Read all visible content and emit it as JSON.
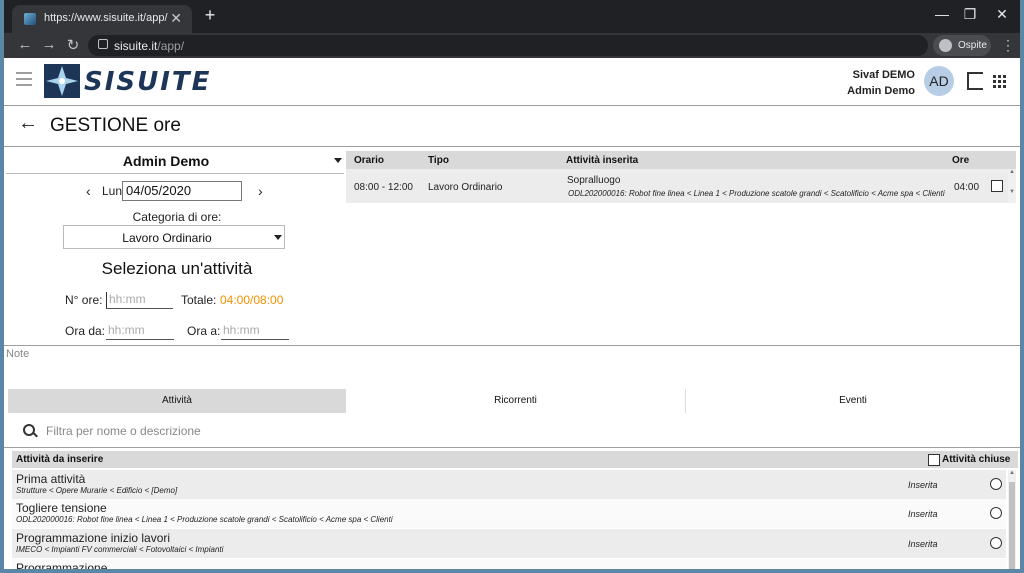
{
  "browser": {
    "tab_title": "https://www.sisuite.it/app/",
    "tab_close": "✕",
    "new_tab": "+",
    "url_host": "sisuite.it",
    "url_path": "/app/",
    "profile": "Ospite",
    "minimize": "—",
    "restore": "❐",
    "close": "✕",
    "back": "←",
    "forward": "→",
    "reload": "↻",
    "menu": "⋮"
  },
  "app": {
    "brand": "SISUITE",
    "user_line1": "Sivaf DEMO",
    "user_line2": "Admin Demo",
    "avatar": "AD"
  },
  "page": {
    "back_arrow": "←",
    "title": "GESTIONE ore"
  },
  "form": {
    "user": "Admin Demo",
    "day_prev": "‹",
    "day_label": "Lun",
    "date": "04/05/2020",
    "day_next": "›",
    "category_label": "Categoria di ore:",
    "category": "Lavoro Ordinario",
    "select_title": "Seleziona un'attività",
    "hours_label": "N° ore:",
    "hours_placeholder": "hh:mm",
    "total_label": "Totale:",
    "total_value": "04:00/08:00",
    "from_label": "Ora da:",
    "from_placeholder": "hh:mm",
    "to_label": "Ora a:",
    "to_placeholder": "hh:mm"
  },
  "entries": {
    "columns": [
      "Orario",
      "Tipo",
      "Attività inserita",
      "Ore"
    ],
    "rows": [
      {
        "orario": "08:00 - 12:00",
        "tipo": "Lavoro Ordinario",
        "attivita": "Sopralluogo",
        "percorso": "ODL202000016: Robot fine linea < Linea 1 < Produzione scatole grandi < Scatolificio < Acme spa < Clienti",
        "ore": "04:00"
      }
    ],
    "scroll_up": "▲",
    "scroll_down": "▼"
  },
  "note": {
    "placeholder": "Note"
  },
  "tabs": [
    "Attività",
    "Ricorrenti",
    "Eventi"
  ],
  "filter": {
    "placeholder": "Filtra per nome o descrizione"
  },
  "activities": {
    "header": "Attività da inserire",
    "closed_label": "Attività chiuse",
    "rows": [
      {
        "title": "Prima attività",
        "path": "Strutture < Opere Murarie < Edificio < [Demo]",
        "status": "Inserita"
      },
      {
        "title": "Togliere tensione",
        "path": "ODL202000016: Robot fine linea < Linea 1 < Produzione scatole grandi < Scatolificio < Acme spa < Clienti",
        "status": "Inserita"
      },
      {
        "title": "Programmazione inizio lavori",
        "path": "IMECO < Impianti FV commerciali < Fotovoltaici < Impianti",
        "status": "Inserita"
      },
      {
        "title": "Programmazione ...",
        "path": "",
        "status": ""
      }
    ]
  }
}
